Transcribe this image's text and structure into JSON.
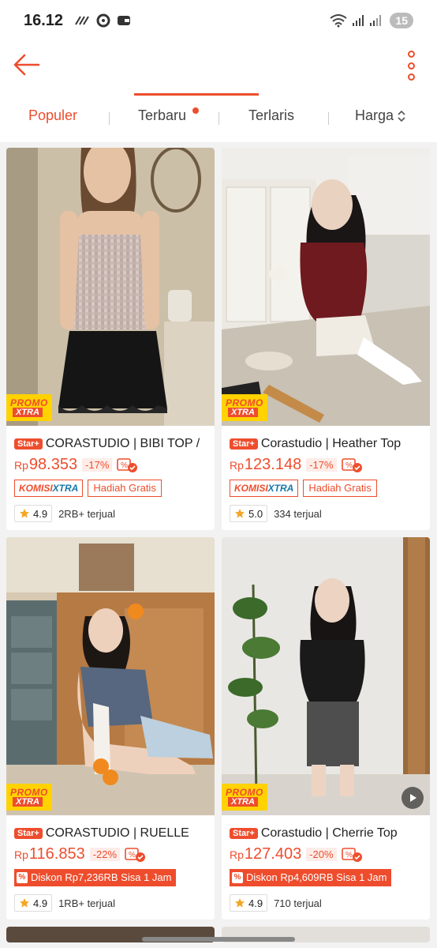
{
  "status_bar": {
    "time": "16.12",
    "battery": "15"
  },
  "sort_tabs": [
    {
      "label": "Populer",
      "active": true
    },
    {
      "label": "Terbaru",
      "active": false,
      "has_dot": true
    },
    {
      "label": "Terlaris",
      "active": false
    },
    {
      "label": "Harga",
      "active": false,
      "icon": "sort-updown-icon"
    }
  ],
  "promo_badge": {
    "line1": "PROMO",
    "line2": "XTRA"
  },
  "products": [
    {
      "badge": "Star+",
      "title": "CORASTUDIO | BIBI TOP /",
      "currency": "Rp",
      "price": "98.353",
      "discount": "-17%",
      "tag_komisi_1": "KOMISI",
      "tag_komisi_2": "XTRA",
      "tag_hadiah": "Hadiah Gratis",
      "rating": "4.9",
      "sold": "2RB+ terjual"
    },
    {
      "badge": "Star+",
      "title": "Corastudio | Heather Top",
      "currency": "Rp",
      "price": "123.148",
      "discount": "-17%",
      "tag_komisi_1": "KOMISI",
      "tag_komisi_2": "XTRA",
      "tag_hadiah": "Hadiah Gratis",
      "rating": "5.0",
      "sold": "334 terjual"
    },
    {
      "badge": "Star+",
      "title": "CORASTUDIO | RUELLE",
      "currency": "Rp",
      "price": "116.853",
      "discount": "-22%",
      "tag_diskon": "Diskon Rp7,236RB Sisa 1 Jam",
      "rating": "4.9",
      "sold": "1RB+ terjual"
    },
    {
      "badge": "Star+",
      "title": "Corastudio | Cherrie Top",
      "currency": "Rp",
      "price": "127.403",
      "discount": "-20%",
      "tag_diskon": "Diskon Rp4,609RB Sisa 1 Jam",
      "rating": "4.9",
      "sold": "710 terjual",
      "has_video": true
    }
  ],
  "colors": {
    "accent": "#ee4d2d",
    "promo_yellow": "#ffd200",
    "star": "#f5a623"
  }
}
